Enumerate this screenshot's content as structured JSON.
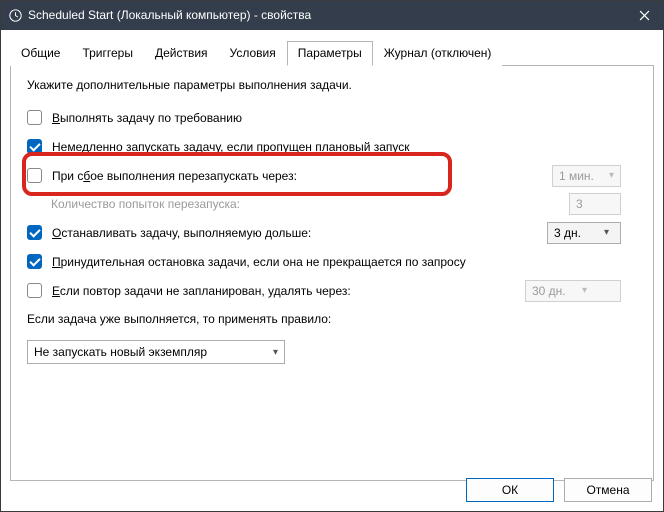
{
  "title": "Scheduled Start (Локальный компьютер) - свойства",
  "tabs": [
    "Общие",
    "Триггеры",
    "Действия",
    "Условия",
    "Параметры",
    "Журнал (отключен)"
  ],
  "active_tab": 4,
  "hint": "Укажите дополнительные параметры выполнения задачи.",
  "options": {
    "allow_demand": {
      "checked": false,
      "label_pre": "В",
      "label_rest": "ыполнять задачу по требованию"
    },
    "run_missed": {
      "checked": true,
      "label_pre": "Н",
      "label_rest": "емедленно запускать задачу, если пропущен плановый запуск"
    },
    "restart": {
      "checked": false,
      "label_pre": "При с",
      "label_ul": "б",
      "label_rest2": "ое выполнения перезапускать через:",
      "interval": "1 мин."
    },
    "restart_count_label": "Количество попыток перезапуска:",
    "restart_count": "3",
    "stop_after": {
      "checked": true,
      "label_pre": "О",
      "label_rest": "станавливать задачу, выполняемую дольше:",
      "value": "3 дн."
    },
    "force_stop": {
      "checked": true,
      "label_pre": "П",
      "label_rest": "ринудительная остановка задачи, если она не прекращается по запросу"
    },
    "delete_after": {
      "checked": false,
      "label_pre": "Е",
      "label_rest": "сли повтор задачи не запланирован, удалять через:",
      "value": "30 дн."
    }
  },
  "rule_label": "Если задача уже выполняется, то применять правило:",
  "rule_value": "Не запускать новый экземпляр",
  "buttons": {
    "ok": "ОК",
    "cancel": "Отмена"
  }
}
